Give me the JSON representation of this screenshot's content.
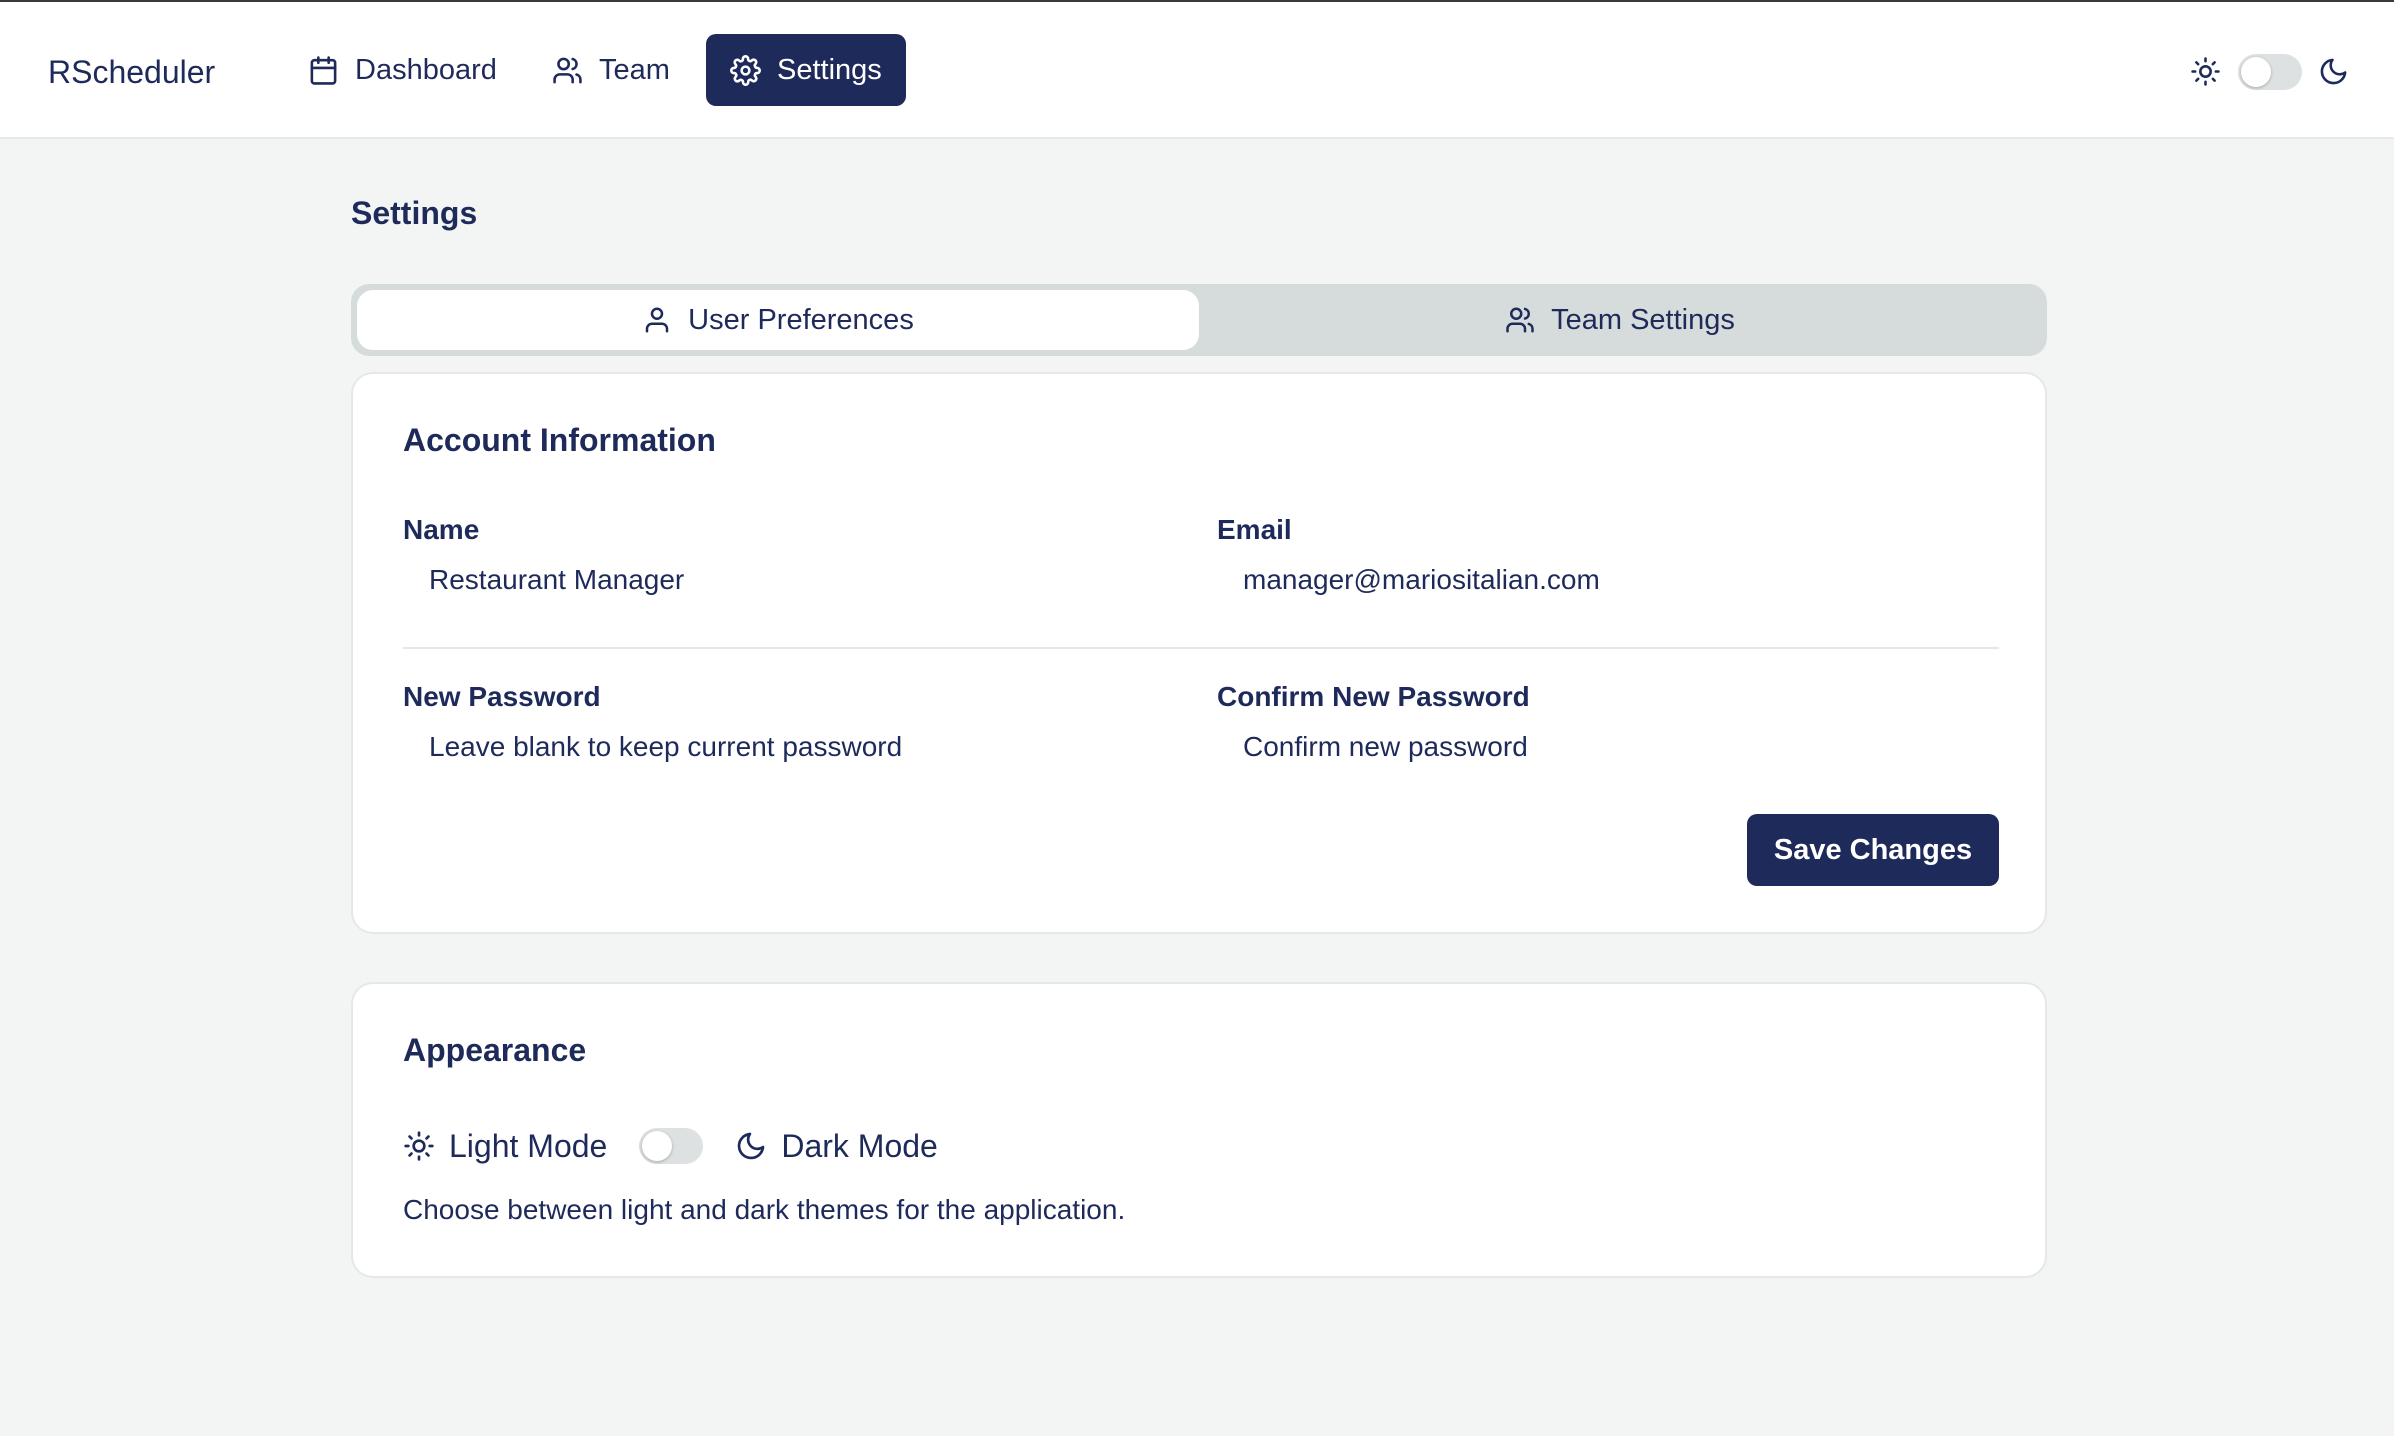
{
  "app": {
    "brand": "RScheduler"
  },
  "nav": {
    "items": [
      {
        "label": "Dashboard",
        "icon": "calendar-icon",
        "active": false
      },
      {
        "label": "Team",
        "icon": "users-icon",
        "active": false
      },
      {
        "label": "Settings",
        "icon": "gear-icon",
        "active": true
      }
    ]
  },
  "header_theme": {
    "sun_icon": "sun-icon",
    "moon_icon": "moon-icon",
    "dark_mode": false
  },
  "page": {
    "title": "Settings"
  },
  "tabs": [
    {
      "label": "User Preferences",
      "icon": "user-icon",
      "active": true
    },
    {
      "label": "Team Settings",
      "icon": "users-icon",
      "active": false
    }
  ],
  "account": {
    "title": "Account Information",
    "name_label": "Name",
    "name_value": "Restaurant Manager",
    "email_label": "Email",
    "email_value": "manager@mariositalian.com",
    "new_password_label": "New Password",
    "new_password_placeholder": "Leave blank to keep current password",
    "confirm_password_label": "Confirm New Password",
    "confirm_password_placeholder": "Confirm new password",
    "save_label": "Save Changes"
  },
  "appearance": {
    "title": "Appearance",
    "light_label": "Light Mode",
    "dark_label": "Dark Mode",
    "description": "Choose between light and dark themes for the application.",
    "dark_mode": false
  },
  "colors": {
    "primary": "#1e2a5a",
    "background": "#f3f5f4",
    "surface": "#ffffff",
    "tab_track": "#d6dcdc",
    "toggle_off": "#dde1e2"
  }
}
